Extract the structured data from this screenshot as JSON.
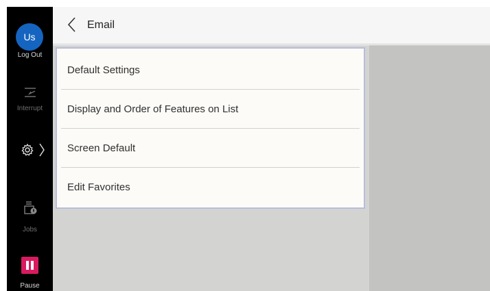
{
  "sidebar": {
    "avatar_initials": "Us",
    "logout_label": "Log Out",
    "interrupt_label": "Interrupt",
    "jobs_label": "Jobs",
    "pause_label": "Pause",
    "icons": [
      "interrupt-icon",
      "gear-icon",
      "chevron-right-icon",
      "jobs-printer-icon",
      "pause-icon"
    ],
    "colors": {
      "avatar": "#1565c0",
      "pause": "#d81b60"
    }
  },
  "header": {
    "back_icon": "chevron-left-icon",
    "title": "Email"
  },
  "menu": {
    "items": [
      {
        "label": "Default Settings"
      },
      {
        "label": "Display and Order of Features on List"
      },
      {
        "label": "Screen Default"
      },
      {
        "label": "Edit Favorites"
      }
    ]
  }
}
